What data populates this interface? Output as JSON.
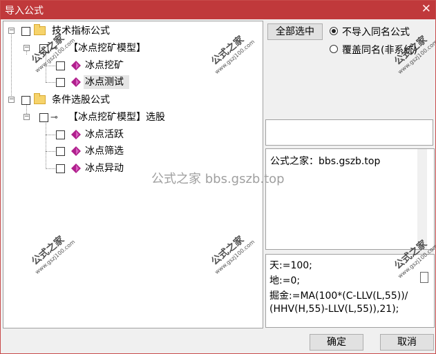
{
  "window": {
    "title": "导入公式",
    "close_glyph": "✕"
  },
  "tree": {
    "groups": [
      {
        "label": "技术指标公式",
        "children": [
          {
            "label": "【冰点挖矿模型】",
            "children": [
              {
                "label": "冰点挖矿"
              },
              {
                "label": "冰点测试"
              }
            ]
          }
        ]
      },
      {
        "label": "条件选股公式",
        "children": [
          {
            "label": "【冰点挖矿模型】选股",
            "children": [
              {
                "label": "冰点活跃"
              },
              {
                "label": "冰点筛选"
              },
              {
                "label": "冰点异动"
              }
            ]
          }
        ]
      }
    ]
  },
  "options": {
    "select_all_label": "全部选中",
    "radio_skip_label": "不导入同名公式",
    "radio_overwrite_label": "覆盖同名(非系统)",
    "selected_radio": "skip"
  },
  "source_text": "公式之家：bbs.gszb.top",
  "code_lines": [
    "天:=100;",
    "地:=0;",
    "掘金:=MA(100*(C-LLV(L,55))/",
    "(HHV(H,55)-LLV(L,55)),21);"
  ],
  "buttons": {
    "ok_label": "确定",
    "cancel_label": "取消"
  },
  "watermark": {
    "line1": "公式之家",
    "line2": "www.gszj100.com",
    "center": "公式之家 bbs.gszb.top"
  },
  "colors": {
    "titlebar": "#c0393b",
    "diamond": "#b0208c"
  }
}
